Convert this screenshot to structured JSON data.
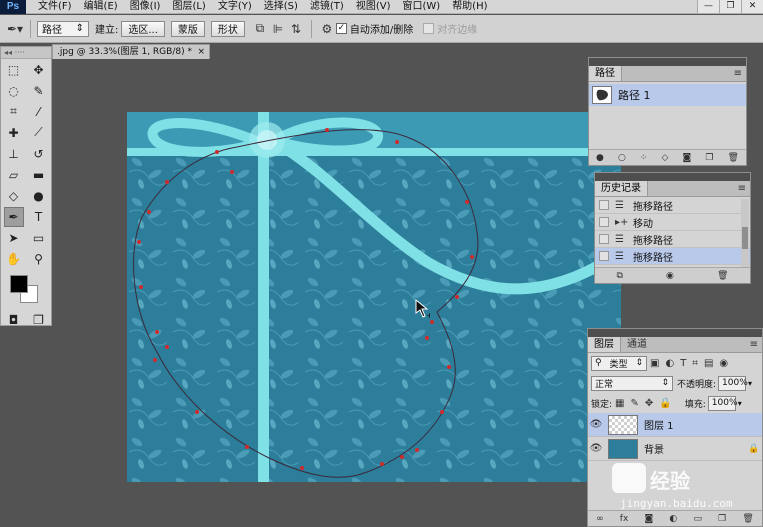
{
  "app": {
    "logo": "Ps",
    "menus": [
      "文件(F)",
      "编辑(E)",
      "图像(I)",
      "图层(L)",
      "文字(Y)",
      "选择(S)",
      "滤镜(T)",
      "视图(V)",
      "窗口(W)",
      "帮助(H)"
    ]
  },
  "options": {
    "mode_select": "路径",
    "build_label": "建立:",
    "selection_btn": "选区...",
    "mask_btn": "蒙版",
    "shape_btn": "形状",
    "auto_add_delete": "自动添加/删除",
    "align_edges": "对齐边缘"
  },
  "document": {
    "tab_title": ".jpg @ 33.3%(图层 1, RGB/8) *",
    "close": "×"
  },
  "panels": {
    "paths": {
      "tab": "路径",
      "items": [
        {
          "name": "路径 1"
        }
      ]
    },
    "history": {
      "tab": "历史记录",
      "items": [
        {
          "label": "拖移路径",
          "icon": "document-icon"
        },
        {
          "label": "移动",
          "icon": "move-icon"
        },
        {
          "label": "拖移路径",
          "icon": "document-icon"
        },
        {
          "label": "拖移路径",
          "icon": "document-icon"
        }
      ]
    },
    "layers": {
      "tabs": [
        "图层",
        "通道"
      ],
      "filter_kind": "类型",
      "blend_mode": "正常",
      "opacity_label": "不透明度:",
      "opacity_value": "100%",
      "lock_label": "锁定:",
      "fill_label": "填充:",
      "fill_value": "100%",
      "items": [
        {
          "name": "图层 1",
          "selected": true
        },
        {
          "name": "背景",
          "selected": false,
          "locked": true
        }
      ]
    }
  },
  "watermark": {
    "brand": "经验",
    "url": "jingyan.baidu.com"
  },
  "colors": {
    "canvas_bg": "#2d7e9a",
    "ribbon": "#7fe0e6",
    "selection_highlight": "#b9c9ea"
  }
}
